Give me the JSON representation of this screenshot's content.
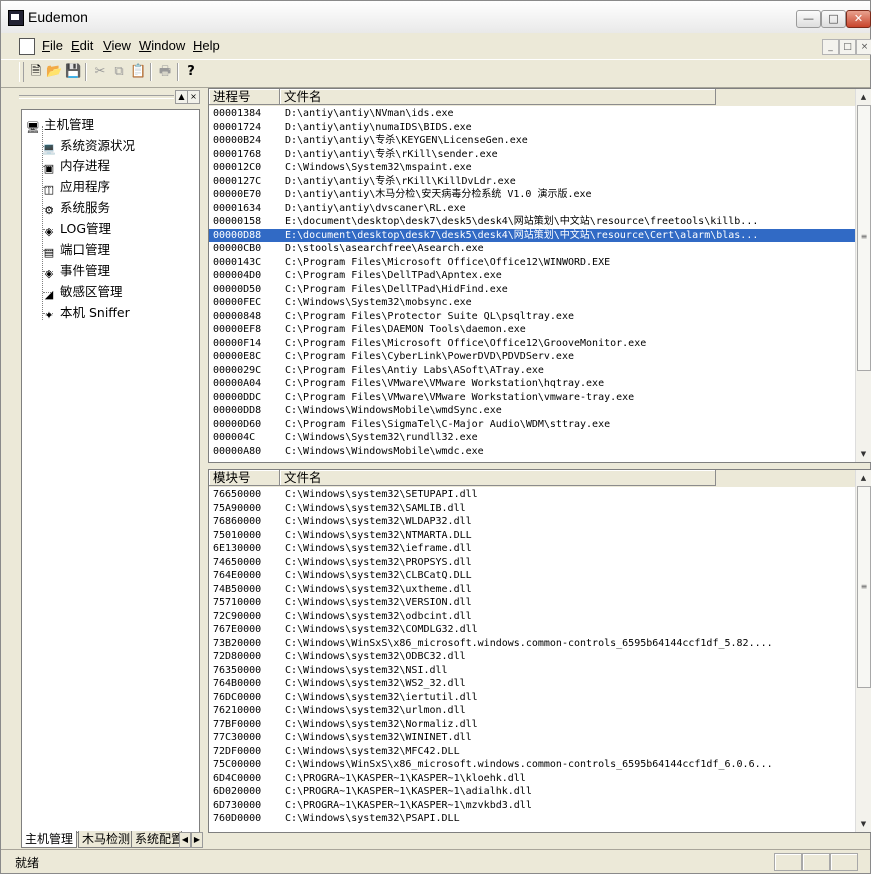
{
  "window": {
    "title": "Eudemon"
  },
  "menu": [
    {
      "key": "F",
      "rest": "ile"
    },
    {
      "key": "E",
      "rest": "dit"
    },
    {
      "key": "V",
      "rest": "iew"
    },
    {
      "key": "W",
      "rest": "indow"
    },
    {
      "key": "H",
      "rest": "elp"
    }
  ],
  "toolbar": {
    "icons": [
      "new-icon",
      "open-icon",
      "save-icon",
      "cut-icon",
      "copy-icon",
      "paste-icon",
      "print-icon",
      "help-icon"
    ]
  },
  "tree": {
    "root": "主机管理",
    "items": [
      "系统资源状况",
      "内存进程",
      "应用程序",
      "系统服务",
      "LOG管理",
      "端口管理",
      "事件管理",
      "敏感区管理",
      "本机 Sniffer"
    ]
  },
  "tabs": [
    "主机管理",
    "木马检测",
    "系统配置"
  ],
  "process_list": {
    "columns": [
      "进程号",
      "文件名"
    ],
    "selected_index": 9,
    "rows": [
      [
        "00001384",
        "D:\\antiy\\antiy\\NVman\\ids.exe"
      ],
      [
        "00001724",
        "D:\\antiy\\antiy\\numaIDS\\BIDS.exe"
      ],
      [
        "00000B24",
        "D:\\antiy\\antiy\\专杀\\KEYGEN\\LicenseGen.exe"
      ],
      [
        "00001768",
        "D:\\antiy\\antiy\\专杀\\rKill\\sender.exe"
      ],
      [
        "000012C0",
        "C:\\Windows\\System32\\mspaint.exe"
      ],
      [
        "0000127C",
        "D:\\antiy\\antiy\\专杀\\rKill\\KillDvLdr.exe"
      ],
      [
        "00000E70",
        "D:\\antiy\\antiy\\木马分检\\安天病毒分检系统  V1.0 演示版.exe"
      ],
      [
        "00001634",
        "D:\\antiy\\antiy\\dvscaner\\RL.exe"
      ],
      [
        "00000158",
        "E:\\document\\desktop\\desk7\\desk5\\desk4\\网站策划\\中文站\\resource\\freetools\\killb..."
      ],
      [
        "00000D88",
        "E:\\document\\desktop\\desk7\\desk5\\desk4\\网站策划\\中文站\\resource\\Cert\\alarm\\blas..."
      ],
      [
        "00000CB0",
        "D:\\stools\\asearchfree\\Asearch.exe"
      ],
      [
        "0000143C",
        "C:\\Program Files\\Microsoft Office\\Office12\\WINWORD.EXE"
      ],
      [
        "000004D0",
        "C:\\Program Files\\DellTPad\\Apntex.exe"
      ],
      [
        "00000D50",
        "C:\\Program Files\\DellTPad\\HidFind.exe"
      ],
      [
        "00000FEC",
        "C:\\Windows\\System32\\mobsync.exe"
      ],
      [
        "00000848",
        "C:\\Program Files\\Protector Suite QL\\psqltray.exe"
      ],
      [
        "00000EF8",
        "C:\\Program Files\\DAEMON Tools\\daemon.exe"
      ],
      [
        "00000F14",
        "C:\\Program Files\\Microsoft Office\\Office12\\GrooveMonitor.exe"
      ],
      [
        "00000E8C",
        "C:\\Program Files\\CyberLink\\PowerDVD\\PDVDServ.exe"
      ],
      [
        "0000029C",
        "C:\\Program Files\\Antiy Labs\\ASoft\\ATray.exe"
      ],
      [
        "00000A04",
        "C:\\Program Files\\VMware\\VMware Workstation\\hqtray.exe"
      ],
      [
        "00000DDC",
        "C:\\Program Files\\VMware\\VMware Workstation\\vmware-tray.exe"
      ],
      [
        "00000DD8",
        "C:\\Windows\\WindowsMobile\\wmdSync.exe"
      ],
      [
        "00000D60",
        "C:\\Program Files\\SigmaTel\\C-Major Audio\\WDM\\sttray.exe"
      ],
      [
        "000004C",
        "C:\\Windows\\System32\\rundll32.exe"
      ],
      [
        "00000A80",
        "C:\\Windows\\WindowsMobile\\wmdc.exe"
      ]
    ]
  },
  "module_list": {
    "columns": [
      "模块号",
      "文件名"
    ],
    "rows": [
      [
        "76650000",
        "C:\\Windows\\system32\\SETUPAPI.dll"
      ],
      [
        "75A90000",
        "C:\\Windows\\system32\\SAMLIB.dll"
      ],
      [
        "76860000",
        "C:\\Windows\\system32\\WLDAP32.dll"
      ],
      [
        "75010000",
        "C:\\Windows\\system32\\NTMARTA.DLL"
      ],
      [
        "6E130000",
        "C:\\Windows\\system32\\ieframe.dll"
      ],
      [
        "74650000",
        "C:\\Windows\\system32\\PROPSYS.dll"
      ],
      [
        "764E0000",
        "C:\\Windows\\system32\\CLBCatQ.DLL"
      ],
      [
        "74B50000",
        "C:\\Windows\\system32\\uxtheme.dll"
      ],
      [
        "75710000",
        "C:\\Windows\\system32\\VERSION.dll"
      ],
      [
        "72C90000",
        "C:\\Windows\\system32\\odbcint.dll"
      ],
      [
        "767E0000",
        "C:\\Windows\\system32\\COMDLG32.dll"
      ],
      [
        "73B20000",
        "C:\\Windows\\WinSxS\\x86_microsoft.windows.common-controls_6595b64144ccf1df_5.82...."
      ],
      [
        "72D80000",
        "C:\\Windows\\system32\\ODBC32.dll"
      ],
      [
        "76350000",
        "C:\\Windows\\system32\\NSI.dll"
      ],
      [
        "764B0000",
        "C:\\Windows\\system32\\WS2_32.dll"
      ],
      [
        "76DC0000",
        "C:\\Windows\\system32\\iertutil.dll"
      ],
      [
        "76210000",
        "C:\\Windows\\system32\\urlmon.dll"
      ],
      [
        "77BF0000",
        "C:\\Windows\\system32\\Normaliz.dll"
      ],
      [
        "77C30000",
        "C:\\Windows\\system32\\WININET.dll"
      ],
      [
        "72DF0000",
        "C:\\Windows\\system32\\MFC42.DLL"
      ],
      [
        "75C00000",
        "C:\\Windows\\WinSxS\\x86_microsoft.windows.common-controls_6595b64144ccf1df_6.0.6..."
      ],
      [
        "6D4C0000",
        "C:\\PROGRA~1\\KASPER~1\\KASPER~1\\kloehk.dll"
      ],
      [
        "6D020000",
        "C:\\PROGRA~1\\KASPER~1\\KASPER~1\\adialhk.dll"
      ],
      [
        "6D730000",
        "C:\\PROGRA~1\\KASPER~1\\KASPER~1\\mzvkbd3.dll"
      ],
      [
        "760D0000",
        "C:\\Windows\\system32\\PSAPI.DLL"
      ]
    ]
  },
  "status": {
    "text": "就绪"
  }
}
